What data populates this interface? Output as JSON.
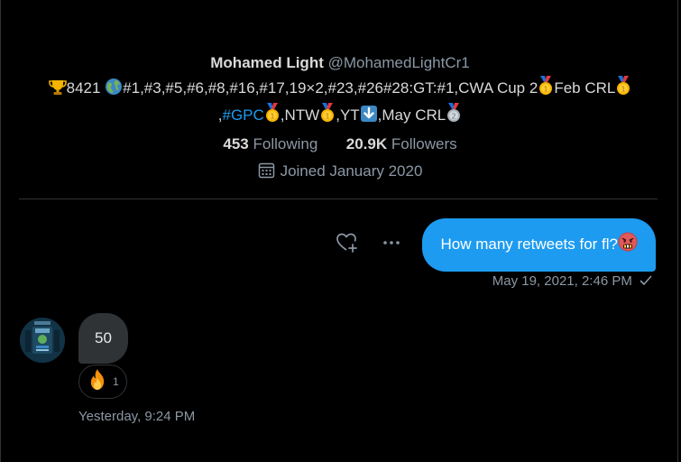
{
  "profile": {
    "display_name": "Mohamed Light",
    "handle": "@MohamedLightCr1",
    "bio": {
      "trophy_emoji": "trophy-emoji",
      "trophies": "8421 ",
      "globe_emoji": "globe-emoji",
      "ranks": "#1,#3,#5,#6,#8,#16,#17,19×2,#23,#26#28:GT:#1,CWA Cup 2",
      "medal_emoji": "first-place-medal-emoji",
      "feb_crl": "Feb CRL",
      "comma_1": ",",
      "hashtag": "#GPC",
      "ntw": ",NTW",
      "yt": ",YT",
      "down_arrow_emoji": "down-arrow-emoji",
      "may_crl": ",May CRL",
      "silver_medal_emoji": "second-place-medal-emoji"
    },
    "following_count": "453",
    "following_label": "Following",
    "followers_count": "20.9K",
    "followers_label": "Followers",
    "joined": "Joined January 2020"
  },
  "conversation": {
    "sent": {
      "text": "How many retweets for fl?",
      "emoji": "face-with-symbols-emoji",
      "timestamp": "May 19, 2021, 2:46 PM",
      "status_icon": "checkmark-icon"
    },
    "received": {
      "text": "50",
      "reaction_emoji": "fire-emoji",
      "reaction_count": "1",
      "timestamp": "Yesterday, 9:24 PM"
    }
  },
  "colors": {
    "background": "#000000",
    "accent": "#1d9bf0",
    "received_bubble": "#2f3336",
    "muted_text": "#8b98a5",
    "primary_text": "#d9d9d9"
  }
}
